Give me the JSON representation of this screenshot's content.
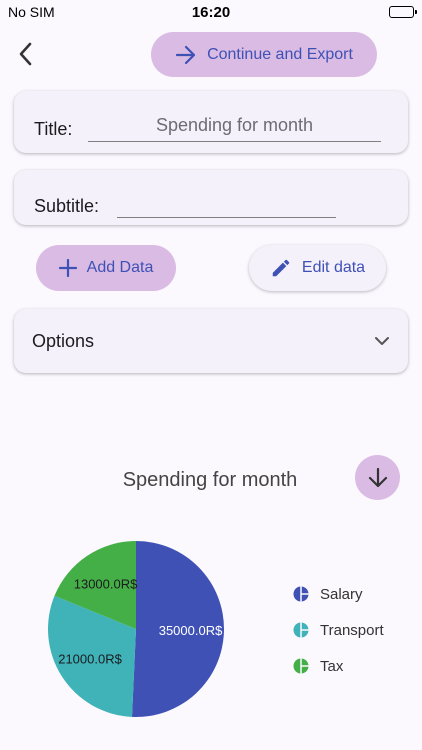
{
  "status_bar": {
    "carrier": "No SIM",
    "time": "16:20"
  },
  "header": {
    "export_label": "Continue and Export"
  },
  "title_field": {
    "label": "Title:",
    "value": "Spending for month"
  },
  "subtitle_field": {
    "label": "Subtitle:",
    "value": ""
  },
  "actions": {
    "add_data_label": "Add Data",
    "edit_data_label": "Edit data"
  },
  "options": {
    "label": "Options"
  },
  "colors": {
    "accent": "#3f51b5",
    "button_fill": "#d9bbe3",
    "salary": "#3f51b5",
    "transport": "#3fb3b8",
    "tax": "#44af47"
  },
  "chart_data": {
    "type": "pie",
    "title": "Spending for month",
    "unit_suffix": "R$",
    "slices": [
      {
        "name": "Salary",
        "value": 35000.0,
        "label": "35000.0R$",
        "color": "#3f51b5"
      },
      {
        "name": "Transport",
        "value": 21000.0,
        "label": "21000.0R$",
        "color": "#3fb3b8"
      },
      {
        "name": "Tax",
        "value": 13000.0,
        "label": "13000.0R$",
        "color": "#44af47"
      }
    ],
    "legend_position": "right"
  }
}
